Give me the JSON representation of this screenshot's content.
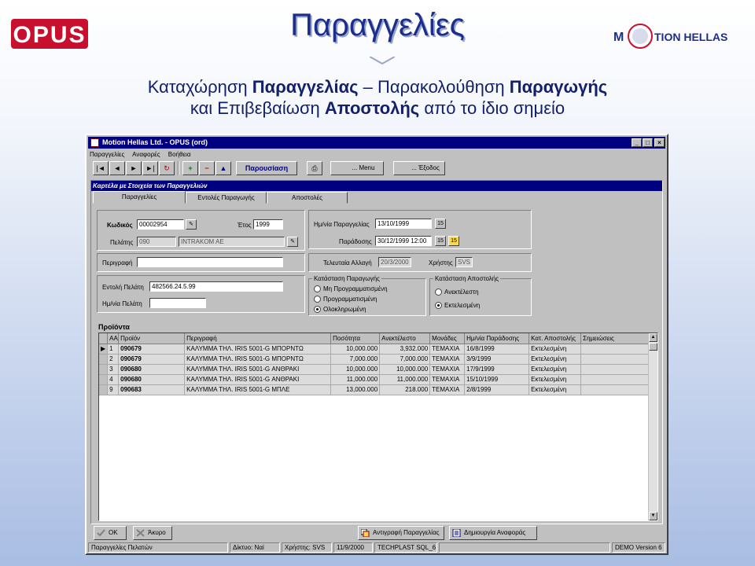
{
  "slide": {
    "title": "Παραγγελίες",
    "logo_left": "OPUS",
    "logo_right_pre": "M",
    "logo_right_post": "TION HELLAS",
    "subtitle_l1_a": "Καταχώρηση ",
    "subtitle_l1_b": "Παραγγελίας",
    "subtitle_l1_c": " – Παρακολούθηση ",
    "subtitle_l1_d": "Παραγωγής",
    "subtitle_l2_a": "και Επιβεβαίωση ",
    "subtitle_l2_b": "Αποστολής",
    "subtitle_l2_c": " από το ίδιο σημείο"
  },
  "window": {
    "title": "Motion Hellas Ltd. - OPUS (ord)",
    "menu": [
      "Παραγγελίες",
      "Αναφορές",
      "Βοήθεια"
    ],
    "toolbar": {
      "present_label": "Παρουσίαση",
      "menu_label": "... Menu",
      "exit_label": "... Έξοδος"
    },
    "form_header": "Καρτέλα με Στοιχεία των Παραγγελιών",
    "tabs": [
      "Παραγγελίες",
      "Εντολές Παραγωγής",
      "Αποστολές"
    ]
  },
  "order": {
    "code_label": "Κωδικός",
    "code_value": "00002954",
    "year_label": "Έτος",
    "year_value": "1999",
    "customer_label": "Πελάτης",
    "customer_code": "090",
    "customer_name": "INTRAKOM AE",
    "description_label": "Περιγραφή",
    "description_value": "",
    "order_date_label": "Ημ/νία Παραγγελίας",
    "order_date_value": "13/10/1999",
    "delivery_label": "Παράδοσης",
    "delivery_value": "30/12/1999 12:00",
    "last_change_label": "Τελευταία Αλλαγή",
    "last_change_value": "20/3/2000",
    "user_label": "Χρήστης",
    "user_value": "SVS",
    "cust_order_label": "Εντολή Πελάτη",
    "cust_order_value": "482566.24.5.99",
    "cust_date_label": "Ημ/νία Πελάτη",
    "cust_date_value": "",
    "calendar_btn": "15"
  },
  "production_status": {
    "title": "Κατάσταση Παραγωγής",
    "options": [
      "Μη Προγραμματισμένη",
      "Προγραμματισμένη",
      "Ολοκληρωμένη"
    ],
    "selected": 2
  },
  "shipment_status": {
    "title": "Κατάσταση Αποστολής",
    "options": [
      "Ανεκτέλεστη",
      "Εκτελεσμένη"
    ],
    "selected": 1
  },
  "products": {
    "title": "Προϊόντα",
    "columns": [
      "ΑΑ",
      "Προϊόν",
      "Περιγραφή",
      "Ποσότητα",
      "Ανεκτέλεστο",
      "Μονάδες",
      "Ημ/νία Παράδοσης",
      "Κατ. Αποστολής",
      "Σημειώσεις"
    ],
    "rows": [
      [
        "1",
        "090679",
        "ΚΑΛΥΜΜΑ ΤΗΛ. IRIS 5001-G ΜΠΟΡΝΤΩ",
        "10,000.000",
        "3,932.000",
        "ΤΕΜΑΧΙΑ",
        "16/8/1999",
        "Εκτελεσμένη",
        ""
      ],
      [
        "2",
        "090679",
        "ΚΑΛΥΜΜΑ ΤΗΛ. IRIS 5001-G ΜΠΟΡΝΤΩ",
        "7,000.000",
        "7,000.000",
        "ΤΕΜΑΧΙΑ",
        "3/9/1999",
        "Εκτελεσμένη",
        ""
      ],
      [
        "3",
        "090680",
        "ΚΑΛΥΜΜΑ ΤΗΛ. IRIS 5001-G ΑΝΘΡΑΚΙ",
        "10,000.000",
        "10,000.000",
        "ΤΕΜΑΧΙΑ",
        "17/9/1999",
        "Εκτελεσμένη",
        ""
      ],
      [
        "4",
        "090680",
        "ΚΑΛΥΜΜΑ ΤΗΛ. IRIS 5001-G ΑΝΘΡΑΚΙ",
        "11,000.000",
        "11,000.000",
        "ΤΕΜΑΧΙΑ",
        "15/10/1999",
        "Εκτελεσμένη",
        ""
      ],
      [
        "9",
        "090683",
        "ΚΑΛΥΜΜΑ ΤΗΛ. IRIS 5001-G ΜΠΛΕ",
        "13,000.000",
        "218.000",
        "ΤΕΜΑΧΙΑ",
        "2/8/1999",
        "Εκτελεσμένη",
        ""
      ]
    ]
  },
  "bottom": {
    "ok_label": "OK",
    "cancel_label": "Άκυρο",
    "copy_label": "Αντιγραφή Παραγγελίας",
    "report_label": "Δημιουργία Αναφοράς"
  },
  "status": {
    "form": "Παραγγελίες Πελατών",
    "network": "Δίκτυο: Ναί",
    "user": "Χρήστης: SVS",
    "date": "11/9/2000",
    "db": "TECHPLAST SQL_6",
    "version": "DEMO Version 6"
  },
  "colors": {
    "title_blue": "#1d2d8c",
    "titlebar": "#000080",
    "opus_red": "#c8102e"
  }
}
